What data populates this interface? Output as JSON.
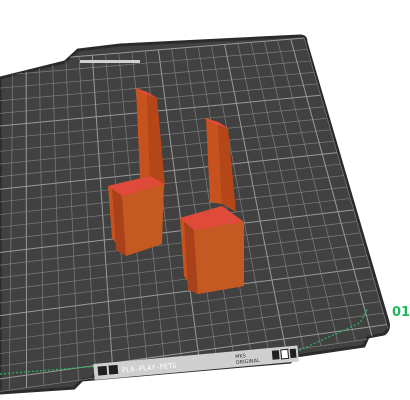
{
  "viewport": {
    "bed_color": "#414141",
    "bed_edge_color": "#2b2b2b",
    "grid_color": "#7d7d7d",
    "grid_major_color": "#9a9a9a",
    "part_color": "#c8521e",
    "part_shadow": "#9f3d16",
    "part_highlight": "#e04a3a",
    "axis_color": "#1fb95a"
  },
  "axis": {
    "label_text": "01"
  },
  "bed_label": {
    "text": "PLA-PLAY-PETG",
    "sub_text_1": "MKS",
    "sub_text_2": "ORIGINAL",
    "left_icon_1": "grid-icon",
    "left_icon_2": "chip-icon",
    "right_icons": [
      "info-icon",
      "square-icon",
      "trash-icon"
    ]
  }
}
